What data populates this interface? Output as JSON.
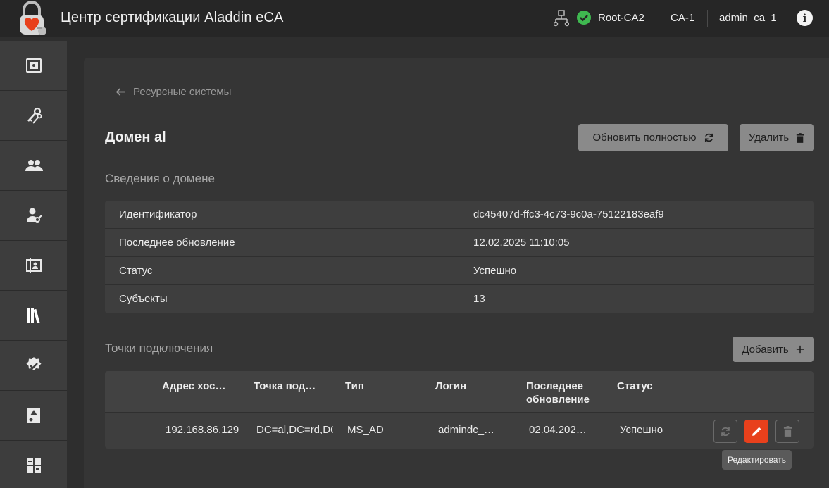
{
  "header": {
    "app_title": "Центр сертификации Aladdin eCA",
    "root_ca": "Root-CA2",
    "ca": "CA-1",
    "user": "admin_ca_1",
    "info_icon": "i",
    "status_color": "#3fb950"
  },
  "sidebar": {
    "items": [
      {
        "icon": "safe-icon"
      },
      {
        "icon": "keys-icon"
      },
      {
        "icon": "users-icon"
      },
      {
        "icon": "user-key-icon"
      },
      {
        "icon": "certificate-user-icon"
      },
      {
        "icon": "library-icon",
        "active": true
      },
      {
        "icon": "verified-badge-icon"
      },
      {
        "icon": "certificate-warning-icon"
      },
      {
        "icon": "dashboard-icon"
      }
    ]
  },
  "main": {
    "back_label": "Ресурсные системы",
    "title": "Домен al",
    "refresh_label": "Обновить полностью",
    "delete_label": "Удалить",
    "domain_section": "Сведения о домене",
    "domain_info": [
      {
        "key": "Идентификатор",
        "value": "dc45407d-ffc3-4c73-9c0a-75122183eaf9"
      },
      {
        "key": "Последнее обновление",
        "value": "12.02.2025 11:10:05"
      },
      {
        "key": "Статус",
        "value": "Успешно"
      },
      {
        "key": "Субъекты",
        "value": "13"
      }
    ],
    "connections_section": "Точки подключения",
    "add_label": "Добавить",
    "columns": {
      "host": "Адрес хос…",
      "point": "Точка под…",
      "type": "Тип",
      "login": "Логин",
      "updated_line1": "Последнее",
      "updated_line2": "обновление",
      "status": "Статус"
    },
    "rows": [
      {
        "host": "192.168.86.129",
        "point": "DC=al,DC=rd,DC",
        "type": "MS_AD",
        "login": "admindc_…",
        "updated": "02.04.202…",
        "status": "Успешно"
      }
    ],
    "tooltip": "Редактировать",
    "accent_color": "#e8401c"
  }
}
